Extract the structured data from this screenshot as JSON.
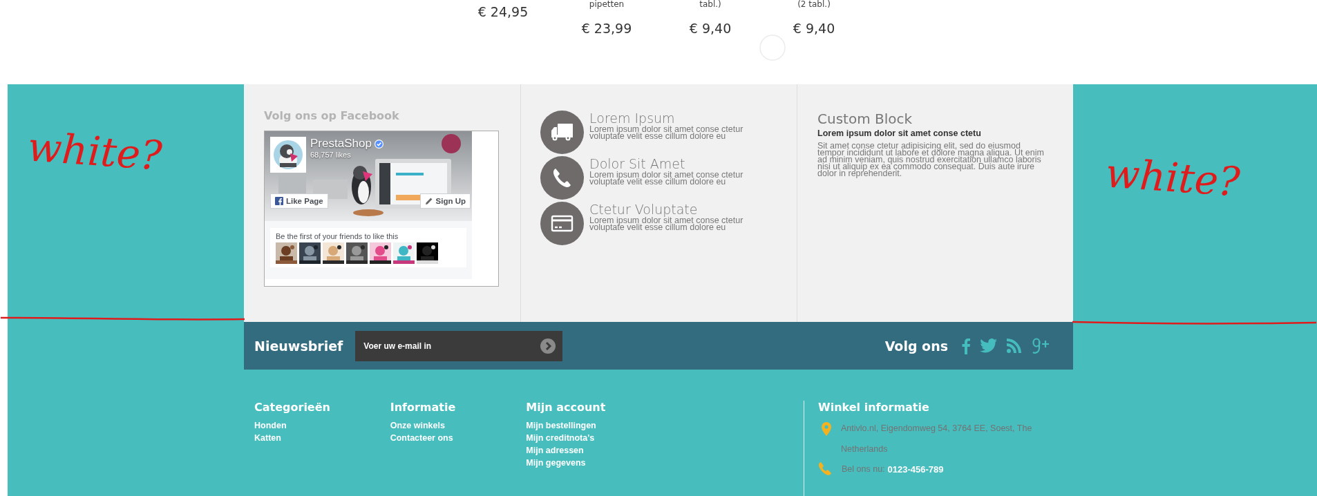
{
  "products": [
    {
      "price": "€ 24,95"
    },
    {
      "name_tail": "pipetten",
      "price": "€ 23,99"
    },
    {
      "name_tail": "tabl.)",
      "price": "€ 9,40"
    },
    {
      "name_tail": "(2 tabl.)",
      "price": "€ 9,40"
    }
  ],
  "facebook": {
    "heading": "Volg ons op Facebook",
    "page_name": "PrestaShop",
    "likes": "68,757 likes",
    "like_button": "Like Page",
    "signup_button": "Sign Up",
    "friends_text": "Be the first of your friends to like this"
  },
  "features": [
    {
      "kind": "truck",
      "title": "Lorem Ipsum",
      "text": "Lorem ipsum dolor sit amet conse ctetur voluptate velit esse cillum dolore eu"
    },
    {
      "kind": "phone",
      "title": "Dolor Sit Amet",
      "text": "Lorem ipsum dolor sit amet conse ctetur voluptate velit esse cillum dolore eu"
    },
    {
      "kind": "card",
      "title": "Ctetur Voluptate",
      "text": "Lorem ipsum dolor sit amet conse ctetur voluptate velit esse cillum dolore eu"
    }
  ],
  "custom_block": {
    "title": "Custom Block",
    "subtitle": "Lorem ipsum dolor sit amet conse ctetu",
    "text": "Sit amet conse ctetur adipisicing elit, sed do eiusmod tempor incididunt ut labore et dolore magna aliqua. Ut enim ad minim veniam, quis nostrud exercitation ullamco laboris nisi ut aliquip ex ea commodo consequat. Duis aute irure dolor in reprehenderit."
  },
  "newsletter": {
    "label": "Nieuwsbrief",
    "placeholder": "Voer uw e-mail in"
  },
  "follow": {
    "label": "Volg ons",
    "networks": [
      {
        "kind": "facebook"
      },
      {
        "kind": "twitter"
      },
      {
        "kind": "rss"
      },
      {
        "kind": "googleplus"
      }
    ]
  },
  "footer_columns": [
    {
      "title": "Categorieën",
      "links": [
        "Honden",
        "Katten"
      ]
    },
    {
      "title": "Informatie",
      "links": [
        "Onze winkels",
        "Contacteer ons"
      ]
    },
    {
      "title": "Mijn account",
      "links": [
        "Mijn bestellingen",
        "Mijn creditnota's",
        "Mijn adressen",
        "Mijn gegevens"
      ]
    }
  ],
  "store_info": {
    "title": "Winkel informatie",
    "address": "Antivlo.nl, Eigendomweg 54, 3764 EE, Soest, The Netherlands",
    "phone_label": "Bel ons nu:",
    "phone": "0123-456-789"
  },
  "annotations": [
    {
      "text": "white?"
    },
    {
      "text": "white?"
    }
  ]
}
